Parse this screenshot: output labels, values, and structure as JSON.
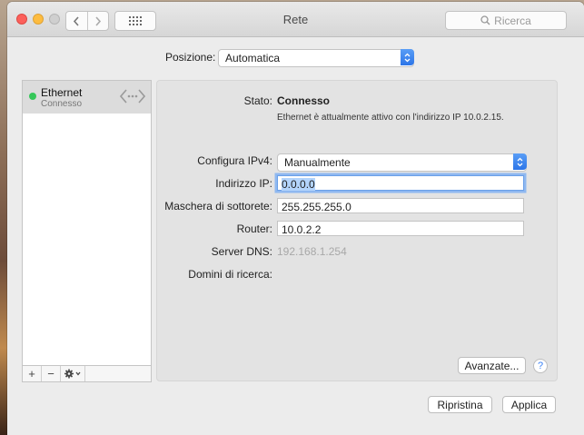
{
  "window": {
    "title": "Rete",
    "search_placeholder": "Ricerca"
  },
  "location": {
    "label": "Posizione:",
    "value": "Automatica"
  },
  "sidebar": {
    "items": [
      {
        "name": "Ethernet",
        "status": "Connesso",
        "status_color": "#35c759"
      }
    ],
    "footer": {
      "add": "+",
      "remove": "−",
      "gear": "gear-icon"
    }
  },
  "details": {
    "status_label": "Stato:",
    "status_value": "Connesso",
    "status_description": "Ethernet è attualmente attivo con l'indirizzo IP 10.0.2.15.",
    "ipv4_label": "Configura IPv4:",
    "ipv4_value": "Manualmente",
    "ip_label": "Indirizzo IP:",
    "ip_value": "0.0.0.0",
    "subnet_label": "Maschera di sottorete:",
    "subnet_value": "255.255.255.0",
    "router_label": "Router:",
    "router_value": "10.0.2.2",
    "dns_label": "Server DNS:",
    "dns_value": "192.168.1.254",
    "search_domains_label": "Domini di ricerca:"
  },
  "buttons": {
    "advanced": "Avanzate...",
    "help": "?",
    "revert": "Ripristina",
    "apply": "Applica"
  },
  "colors": {
    "accent": "#2c75e8",
    "focus_ring": "#8fb8f0"
  }
}
